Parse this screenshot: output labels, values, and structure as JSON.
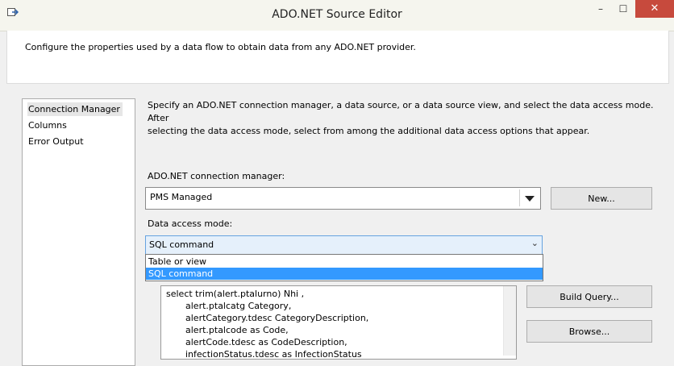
{
  "window": {
    "title": "ADO.NET Source Editor",
    "minimize": "–",
    "maximize": "☐",
    "close": "✕"
  },
  "header": {
    "description": "Configure the properties used by a data flow to obtain data from any ADO.NET provider."
  },
  "nav": {
    "items": [
      "Connection Manager",
      "Columns",
      "Error Output"
    ]
  },
  "main": {
    "intro_line1": "Specify an ADO.NET connection manager, a data source, or a data source view, and select the data access mode. After",
    "intro_line2": "selecting the data access mode, select from among the additional data access options that appear.",
    "connection_label": "ADO.NET connection manager:",
    "connection_value": "PMS Managed",
    "new_button": "New...",
    "access_mode_label": "Data access mode:",
    "access_mode_value": "SQL command",
    "access_mode_options": [
      "Table or view",
      "SQL command"
    ],
    "build_query_button": "Build Query...",
    "browse_button": "Browse...",
    "sql_lines": [
      "select trim(alert.ptalurno) Nhi ,",
      "alert.ptalcatg Category,",
      "alertCategory.tdesc CategoryDescription,",
      "alert.ptalcode as Code,",
      "alertCode.tdesc as CodeDescription,",
      "infectionStatus.tdesc as InfectionStatus"
    ]
  }
}
